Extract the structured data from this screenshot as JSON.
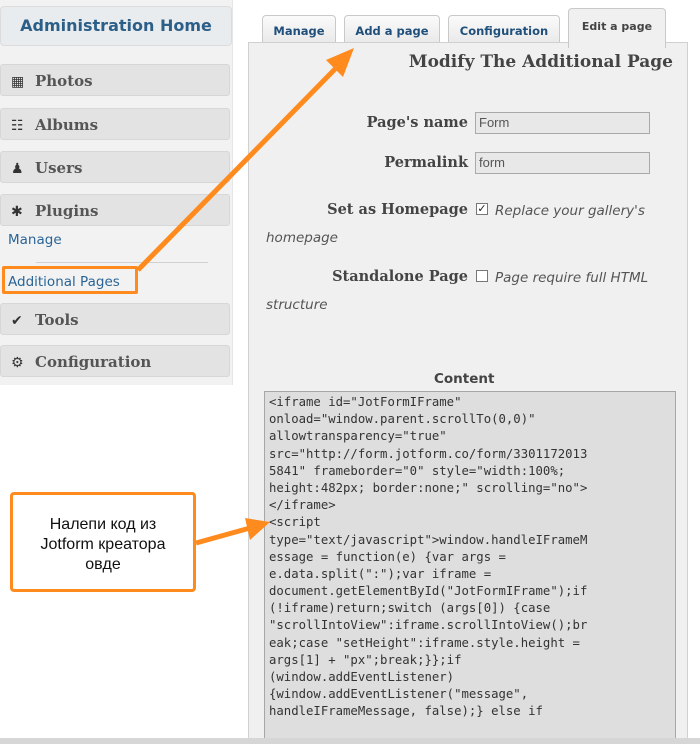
{
  "sidebar": {
    "home_label": "Administration Home",
    "items": [
      {
        "label": "Photos",
        "icon": "photo-icon"
      },
      {
        "label": "Albums",
        "icon": "sitemap-icon"
      },
      {
        "label": "Users",
        "icon": "users-icon"
      },
      {
        "label": "Plugins",
        "icon": "plugins-icon"
      },
      {
        "label": "Tools",
        "icon": "wrench-icon"
      },
      {
        "label": "Configuration",
        "icon": "gear-icon"
      }
    ],
    "plugins_sub": {
      "manage": "Manage",
      "additional_pages": "Additional Pages"
    }
  },
  "tabs": [
    {
      "label": "Manage"
    },
    {
      "label": "Add a page"
    },
    {
      "label": "Configuration"
    },
    {
      "label": "Edit a page",
      "active": true
    }
  ],
  "form": {
    "title": "Modify The Additional Page",
    "page_name_label": "Page's name",
    "page_name_value": "Form",
    "permalink_label": "Permalink",
    "permalink_value": "form",
    "homepage_label": "Set as Homepage",
    "homepage_checked": true,
    "homepage_desc_1": "Replace your gallery's",
    "homepage_desc_2": "homepage",
    "standalone_label": "Standalone Page",
    "standalone_checked": false,
    "standalone_desc_1": "Page require full HTML",
    "standalone_desc_2": "structure",
    "content_label": "Content",
    "content_lines": [
      "<iframe id=\"JotFormIFrame\"",
      "onload=\"window.parent.scrollTo(0,0)\"",
      "allowtransparency=\"true\"",
      "src=\"http://form.jotform.co/form/3301172013",
      "5841\" frameborder=\"0\" style=\"width:100%;",
      "height:482px; border:none;\" scrolling=\"no\">",
      "</iframe>",
      "<script",
      "type=\"text/javascript\">window.handleIFrameM",
      "essage = function(e) {var args =",
      "e.data.split(\":\");var iframe =",
      "document.getElementById(\"JotFormIFrame\");if",
      "(!iframe)return;switch (args[0]) {case",
      "\"scrollIntoView\":iframe.scrollIntoView();br",
      "eak;case \"setHeight\":iframe.style.height =",
      "args[1] + \"px\";break;}};if",
      "(window.addEventListener)",
      "{window.addEventListener(\"message\",",
      "handleIFrameMessage, false);} else if"
    ]
  },
  "callout": {
    "lines": [
      "Налепи код из",
      "Jotform креатора",
      "овде"
    ]
  },
  "colors": {
    "accent": "#ff8a1d",
    "link": "#2a6496"
  }
}
